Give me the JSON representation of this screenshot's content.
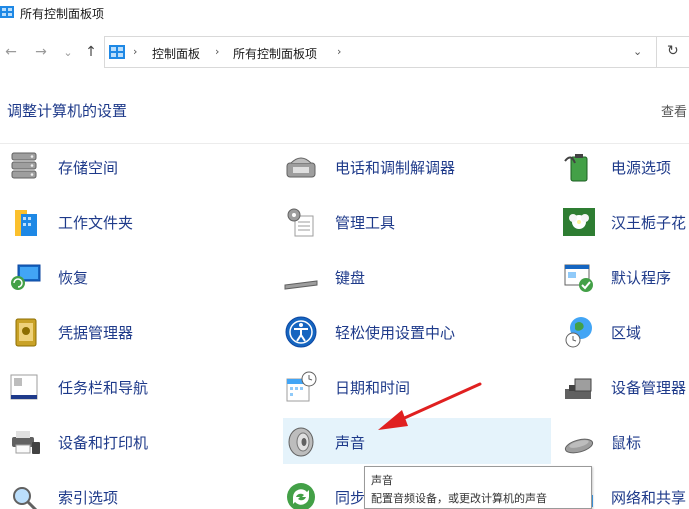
{
  "window": {
    "title": "所有控制面板项"
  },
  "nav": {
    "back": "←",
    "forward": "→",
    "recent": "⌄",
    "up": "↑"
  },
  "address": {
    "crumbs": [
      "控制面板",
      "所有控制面板项"
    ],
    "sep": "›",
    "dropdown": "⌄",
    "refresh": "↻"
  },
  "main": {
    "heading": "调整计算机的设置",
    "view_by": "查看"
  },
  "items": {
    "col1": [
      "存储空间",
      "工作文件夹",
      "恢复",
      "凭据管理器",
      "任务栏和导航",
      "设备和打印机",
      "索引选项"
    ],
    "col2": [
      "电话和调制解调器",
      "管理工具",
      "键盘",
      "轻松使用设置中心",
      "日期和时间",
      "声音",
      "同步"
    ],
    "col3": [
      "电源选项",
      "汉王栀子花",
      "默认程序",
      "区域",
      "设备管理器",
      "鼠标",
      "网络和共享"
    ]
  },
  "tooltip": {
    "title": "声音",
    "description": "配置音频设备，或更改计算机的声音"
  },
  "colors": {
    "link": "#1e3a8a",
    "hover_bg": "#e5f3fb",
    "arrow": "#e02020"
  }
}
